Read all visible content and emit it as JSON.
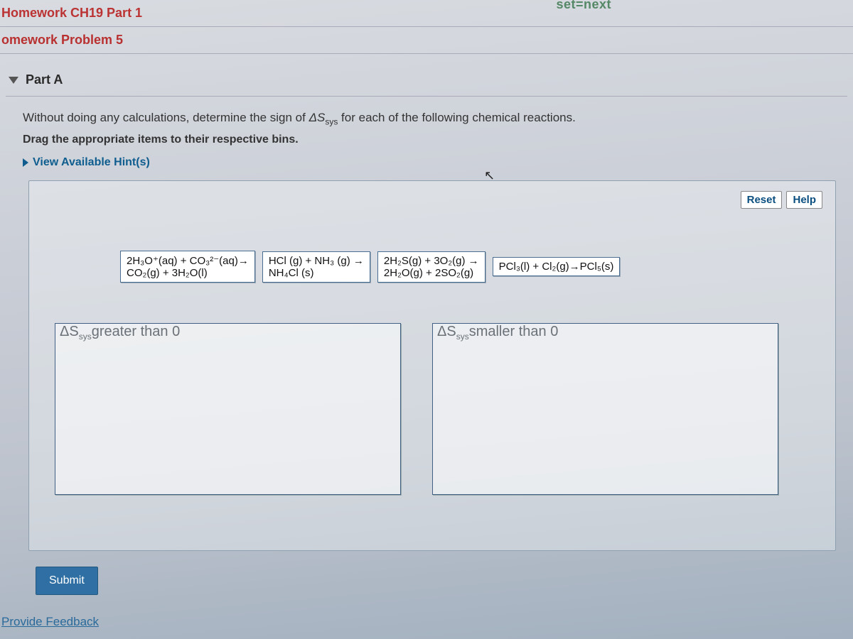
{
  "url_fragment": "set=next",
  "breadcrumbs": {
    "line1": "Homework CH19 Part 1",
    "line2": "omework Problem 5"
  },
  "section": {
    "title": "Part A"
  },
  "question": {
    "prefix": "Without doing any calculations, determine the sign of ",
    "symbol_html": "ΔS",
    "symbol_sub": "sys",
    "suffix": " for each of the following chemical reactions.",
    "instructions": "Drag the appropriate items to their respective bins.",
    "hint_toggle": "View Available Hint(s)"
  },
  "toolbar": {
    "reset": "Reset",
    "help": "Help"
  },
  "tiles": [
    {
      "line1": "2H₃O⁺(aq) + CO₃²⁻(aq)→",
      "line2": "CO₂(g) + 3H₂O(l)"
    },
    {
      "line1": "HCl (g) + NH₃ (g) →",
      "line2": "NH₄Cl (s)"
    },
    {
      "line1": "2H₂S(g) + 3O₂(g) →",
      "line2": "2H₂O(g) + 2SO₂(g)"
    },
    {
      "line1": "PCl₃(l) + Cl₂(g)→PCl₅(s)",
      "line2": ""
    }
  ],
  "bins": {
    "left": "ΔSsysgreater than 0",
    "left_display": {
      "prefix": "ΔS",
      "sub": "sys",
      "text": "greater than 0"
    },
    "right_display": {
      "prefix": "ΔS",
      "sub": "sys",
      "text": "smaller than 0"
    }
  },
  "actions": {
    "submit": "Submit",
    "feedback": "Provide Feedback"
  }
}
